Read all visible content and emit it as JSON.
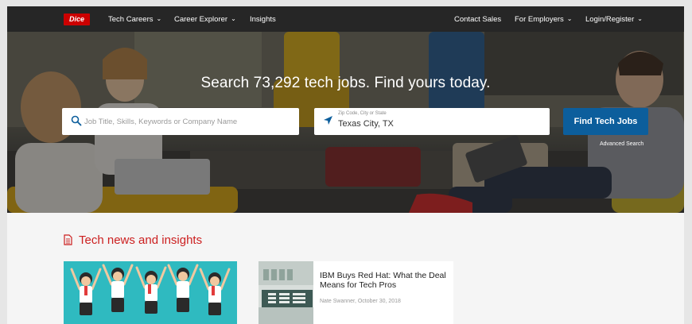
{
  "nav": {
    "logo": "Dice",
    "tech_careers": "Tech Careers",
    "career_explorer": "Career Explorer",
    "insights": "Insights",
    "contact_sales": "Contact Sales",
    "for_employers": "For Employers",
    "login_register": "Login/Register"
  },
  "hero": {
    "title": "Search 73,292 tech jobs. Find yours today.",
    "keyword_placeholder": "Job Title, Skills, Keywords or Company Name",
    "keyword_value": "",
    "location_label": "Zip Code, City or State",
    "location_value": "Texas City, TX",
    "find_button": "Find Tech Jobs",
    "advanced_search": "Advanced Search"
  },
  "news": {
    "heading": "Tech news and insights",
    "articles": [
      {
        "title": "",
        "meta": ""
      },
      {
        "title": "IBM Buys Red Hat: What the Deal Means for Tech Pros",
        "meta": "Nate Swanner, October 30, 2018"
      }
    ]
  },
  "colors": {
    "nav_bg": "#262626",
    "brand_red": "#cc0000",
    "button_blue": "#0c5e9c",
    "heading_red": "#cc1f1f",
    "card_teal": "#2fbac0"
  },
  "icons": [
    "dice-logo",
    "chevron-down-icon",
    "search-icon",
    "location-arrow-icon",
    "document-icon"
  ]
}
